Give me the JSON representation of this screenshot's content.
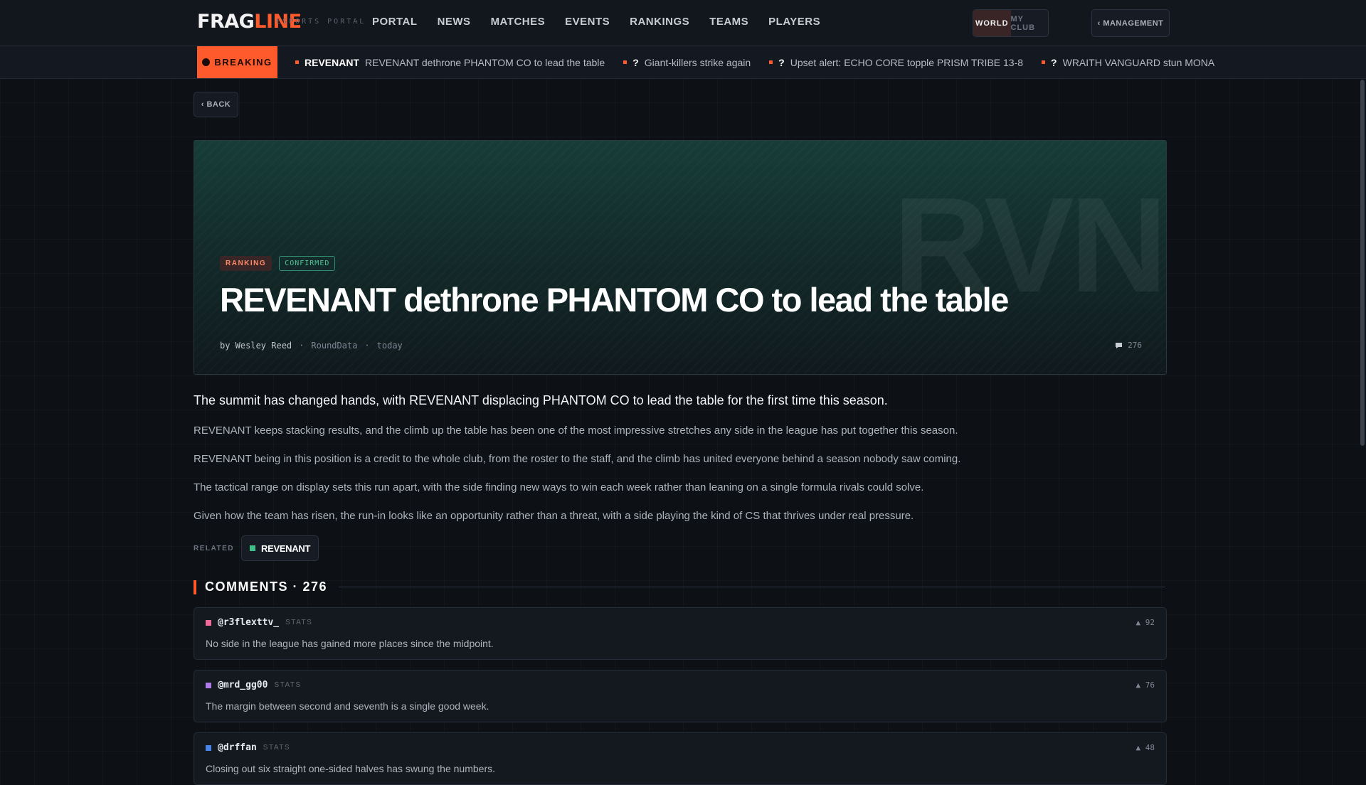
{
  "brand": {
    "name_a": "FRAG",
    "name_b": "LINE",
    "subtitle": "ESPORTS PORTAL",
    "accent": "#ff5a2c"
  },
  "nav": [
    "PORTAL",
    "NEWS",
    "MATCHES",
    "EVENTS",
    "RANKINGS",
    "TEAMS",
    "PLAYERS"
  ],
  "scope_toggle": {
    "world": "WORLD",
    "my_club": "MY CLUB",
    "selected": "WORLD"
  },
  "management_label": "‹ MANAGEMENT",
  "ticker": {
    "label": "BREAKING",
    "items": [
      {
        "team": "REVENANT",
        "text": "REVENANT dethrone PHANTOM CO to lead the table"
      },
      {
        "team": "?",
        "text": "Giant-killers strike again"
      },
      {
        "team": "?",
        "text": "Upset alert: ECHO CORE topple PRISM TRIBE 13-8"
      },
      {
        "team": "?",
        "text": "WRAITH VANGUARD stun MONA"
      }
    ]
  },
  "back_label": "‹ BACK",
  "article": {
    "watermark": "RVN",
    "tag_category": "RANKING",
    "tag_status": "CONFIRMED",
    "headline": "REVENANT dethrone PHANTOM CO to lead the table",
    "author": "by Wesley Reed",
    "source": "RoundData",
    "date": "today",
    "comment_count": "276",
    "lede": "The summit has changed hands, with REVENANT displacing PHANTOM CO to lead the table for the first time this season.",
    "paragraphs": [
      "REVENANT keeps stacking results, and the climb up the table has been one of the most impressive stretches any side in the league has put together this season.",
      "REVENANT being in this position is a credit to the whole club, from the roster to the staff, and the climb has united everyone behind a season nobody saw coming.",
      "The tactical range on display sets this run apart, with the side finding new ways to win each week rather than leaning on a single formula rivals could solve.",
      "Given how the team has risen, the run-in looks like an opportunity rather than a threat, with a side playing the kind of CS that thrives under real pressure."
    ],
    "related_label": "RELATED",
    "related_team": "REVENANT",
    "related_color": "#3dbf8a"
  },
  "comments": {
    "header": "COMMENTS · 276",
    "items": [
      {
        "handle": "@r3flexttv_",
        "role": "STATS",
        "text": "No side in the league has gained more places since the midpoint.",
        "votes": "▲ 92",
        "color": "#f06a9a"
      },
      {
        "handle": "@mrd_gg00",
        "role": "STATS",
        "text": "The margin between second and seventh is a single good week.",
        "votes": "▲ 76",
        "color": "#b07ae8"
      },
      {
        "handle": "@drffan",
        "role": "STATS",
        "text": "Closing out six straight one-sided halves has swung the numbers.",
        "votes": "▲ 48",
        "color": "#4a86e8"
      }
    ]
  }
}
